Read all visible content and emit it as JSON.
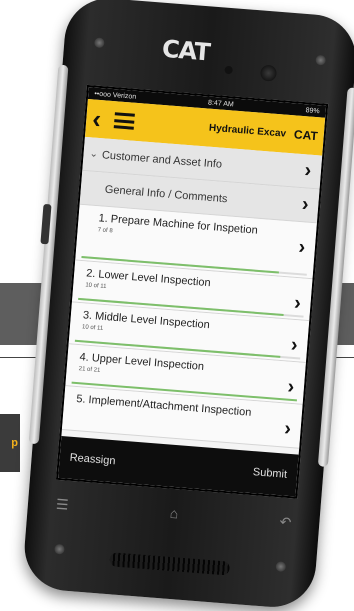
{
  "background": {
    "tag_text": "p"
  },
  "phone": {
    "brand": "CAT"
  },
  "status_bar": {
    "carrier": "••ooo Verizon",
    "time": "8:47 AM",
    "battery": "89%"
  },
  "app_bar": {
    "title": "Hydraulic Excav",
    "brand": "CAT"
  },
  "sections": [
    {
      "label": "Customer and Asset Info"
    },
    {
      "label": "General Info / Comments"
    }
  ],
  "tasks": [
    {
      "name": "1.  Prepare Machine for Inspetion",
      "count": "7 of 8",
      "progress": 0.875
    },
    {
      "name": "2.  Lower Level Inspection",
      "count": "10 of 11",
      "progress": 0.91
    },
    {
      "name": "3.  Middle Level Inspection",
      "count": "10 of 11",
      "progress": 0.91
    },
    {
      "name": "4.  Upper Level Inspection",
      "count": "21 of 21",
      "progress": 1.0
    },
    {
      "name": "5.  Implement/Attachment Inspection",
      "count": "",
      "progress": 0.0
    }
  ],
  "bottom_bar": {
    "left": "Reassign",
    "right": "Submit"
  },
  "colors": {
    "accent": "#f5c31b",
    "progress": "#7dbf6a"
  }
}
